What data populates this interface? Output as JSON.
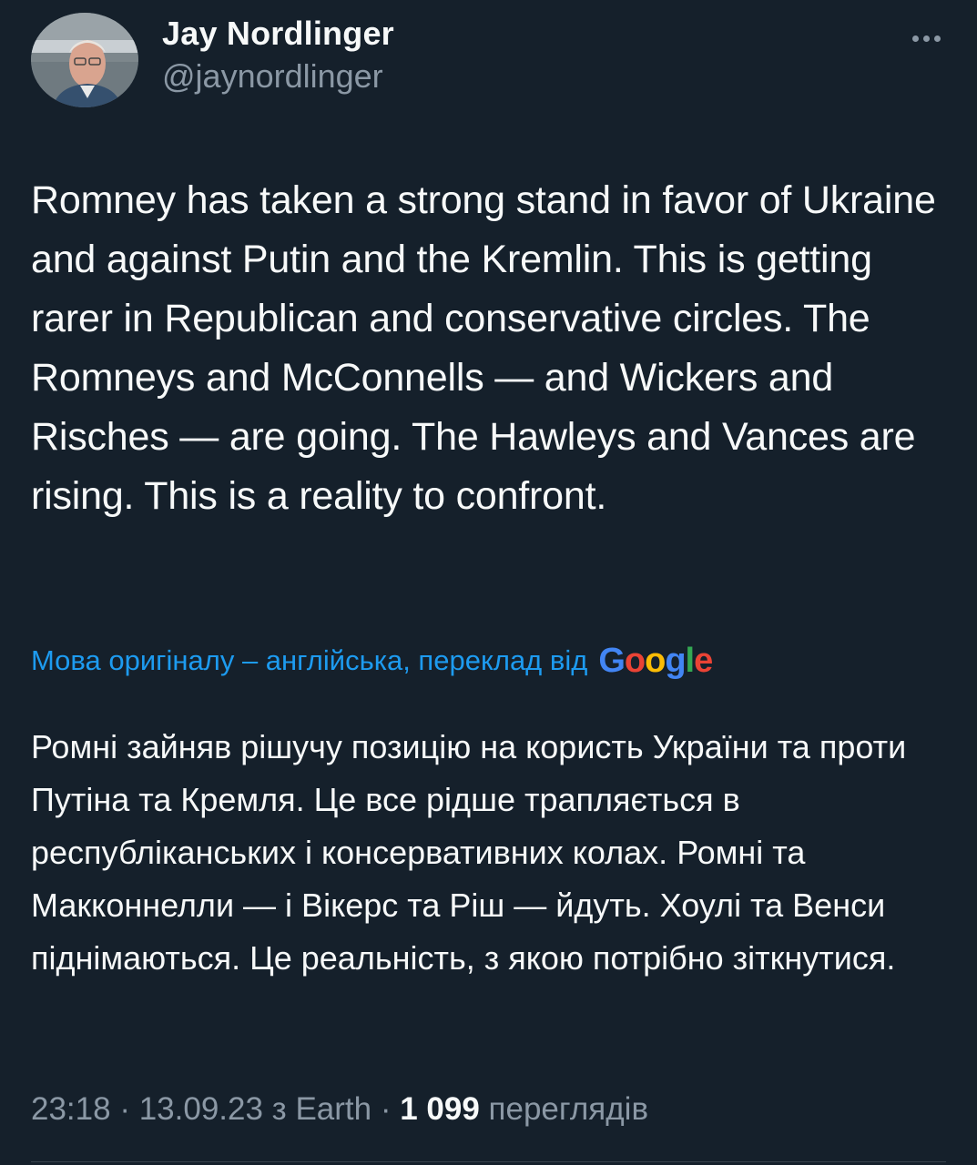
{
  "colors": {
    "background": "#15202b",
    "text_primary": "#f7f9f9",
    "text_secondary": "#8b98a5",
    "accent": "#1d9bf0"
  },
  "author": {
    "display_name": "Jay Nordlinger",
    "handle": "@jaynordlinger",
    "avatar_icon": "profile-photo"
  },
  "more_icon": "more-horizontal-icon",
  "tweet": {
    "text": "Romney has taken a strong stand in favor of Ukraine and against Putin and the Kremlin. This is getting rarer in Republican and conservative circles. The Romneys and McConnells — and Wickers and Risches — are going. The Hawleys and Vances are rising. This is a reality to confront."
  },
  "translation": {
    "label": "Мова оригіналу – англійська, переклад від",
    "provider": "Google",
    "provider_letters": [
      {
        "char": "G",
        "color": "#4285f4"
      },
      {
        "char": "o",
        "color": "#ea4335"
      },
      {
        "char": "o",
        "color": "#fbbc05"
      },
      {
        "char": "g",
        "color": "#4285f4"
      },
      {
        "char": "l",
        "color": "#34a853"
      },
      {
        "char": "e",
        "color": "#ea4335"
      }
    ],
    "text": "Ромні зайняв рішучу позицію на користь України та проти Путіна та Кремля. Це все рідше трапляється в республіканських і консервативних колах. Ромні та Макконнелли — і Вікерс та Ріш — йдуть. Хоулі та Венси піднімаються. Це реальність, з якою потрібно зіткнутися."
  },
  "meta": {
    "time": "23:18",
    "separator": " · ",
    "date": "13.09.23",
    "source_prefix": " з ",
    "source": "Earth",
    "views_count": "1 099",
    "views_label": " переглядів"
  }
}
